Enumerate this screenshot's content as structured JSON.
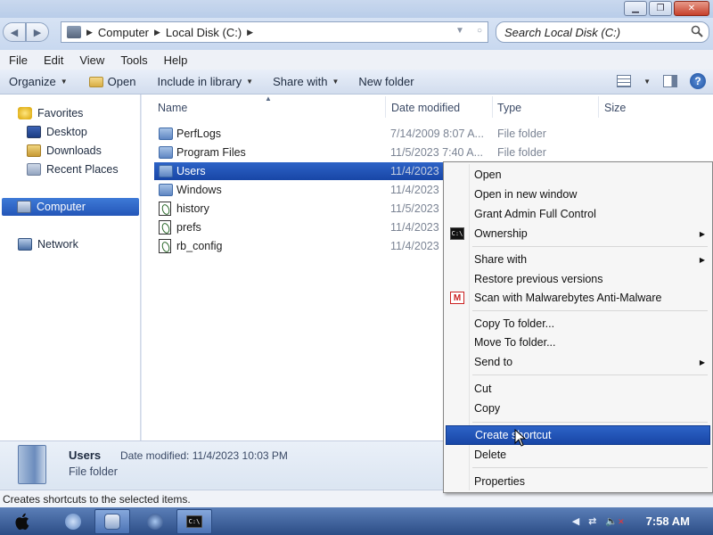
{
  "window": {
    "controls": [
      "minimize-icon",
      "maximize-icon",
      "close-icon"
    ]
  },
  "address": {
    "crumbs": [
      "Computer",
      "Local Disk (C:)"
    ],
    "search_placeholder": "Search Local Disk (C:)"
  },
  "menubar": [
    "File",
    "Edit",
    "View",
    "Tools",
    "Help"
  ],
  "toolbar": {
    "organize": "Organize",
    "open": "Open",
    "include": "Include in library",
    "share": "Share with",
    "new_folder": "New folder"
  },
  "nav": {
    "favorites": "Favorites",
    "desktop": "Desktop",
    "downloads": "Downloads",
    "recent": "Recent Places",
    "computer": "Computer",
    "network": "Network"
  },
  "columns": {
    "name": "Name",
    "date": "Date modified",
    "type": "Type",
    "size": "Size"
  },
  "files": [
    {
      "name": "PerfLogs",
      "date": "7/14/2009 8:07 A...",
      "type": "File folder",
      "icon": "folder-icon"
    },
    {
      "name": "Program Files",
      "date": "11/5/2023 7:40 A...",
      "type": "File folder",
      "icon": "folder-icon"
    },
    {
      "name": "Users",
      "date": "11/4/2023",
      "type": "",
      "icon": "folder-icon",
      "selected": true
    },
    {
      "name": "Windows",
      "date": "11/4/2023",
      "type": "",
      "icon": "folder-icon"
    },
    {
      "name": "history",
      "date": "11/5/2023",
      "type": "",
      "icon": "script-file-icon"
    },
    {
      "name": "prefs",
      "date": "11/4/2023",
      "type": "",
      "icon": "script-file-icon"
    },
    {
      "name": "rb_config",
      "date": "11/4/2023",
      "type": "",
      "icon": "script-file-icon"
    }
  ],
  "details": {
    "name": "Users",
    "type": "File folder",
    "date": "Date modified: 11/4/2023 10:03 PM"
  },
  "status": "Creates shortcuts to the selected items.",
  "clock": "7:58 AM",
  "context_menu": {
    "open": "Open",
    "open_new": "Open in new window",
    "grant": "Grant Admin Full Control",
    "ownership": "Ownership",
    "share": "Share with",
    "restore": "Restore previous versions",
    "malwarebytes": "Scan with Malwarebytes Anti-Malware",
    "copy_to": "Copy To folder...",
    "move_to": "Move To folder...",
    "send_to": "Send to",
    "cut": "Cut",
    "copy": "Copy",
    "create_shortcut": "Create shortcut",
    "delete": "Delete",
    "properties": "Properties"
  },
  "colors": {
    "selection": "#1f52b3",
    "taskbar": "#3b5e97"
  }
}
